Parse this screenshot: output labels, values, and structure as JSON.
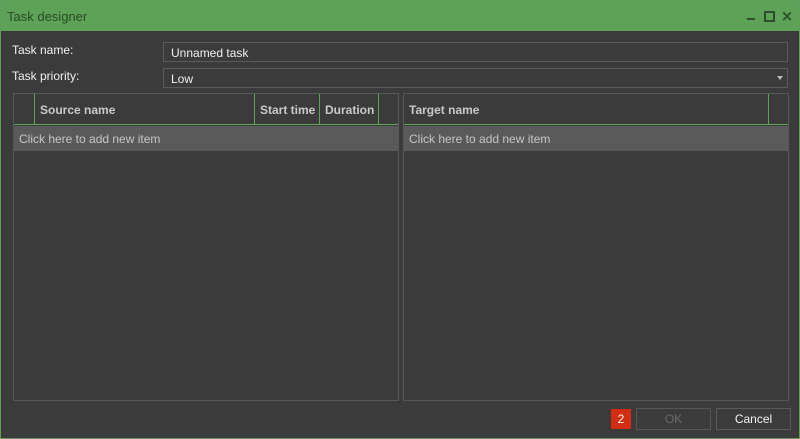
{
  "window": {
    "title": "Task designer",
    "controls": {
      "minimize": "minimize",
      "maximize": "maximize",
      "close": "×"
    }
  },
  "form": {
    "task_name_label": "Task name:",
    "task_name_value": "Unnamed task",
    "task_priority_label": "Task priority:",
    "task_priority_value": "Low"
  },
  "source_grid": {
    "columns": [
      "Source name",
      "Start time",
      "Duration"
    ],
    "add_item_text": "Click here to add new item"
  },
  "target_grid": {
    "columns": [
      "Target name"
    ],
    "add_item_text": "Click here to add new item"
  },
  "footer": {
    "badge_count": "2",
    "ok_label": "OK",
    "cancel_label": "Cancel"
  },
  "colors": {
    "accent": "#5da257",
    "badge": "#d42e12",
    "background": "#3b3b3b"
  }
}
